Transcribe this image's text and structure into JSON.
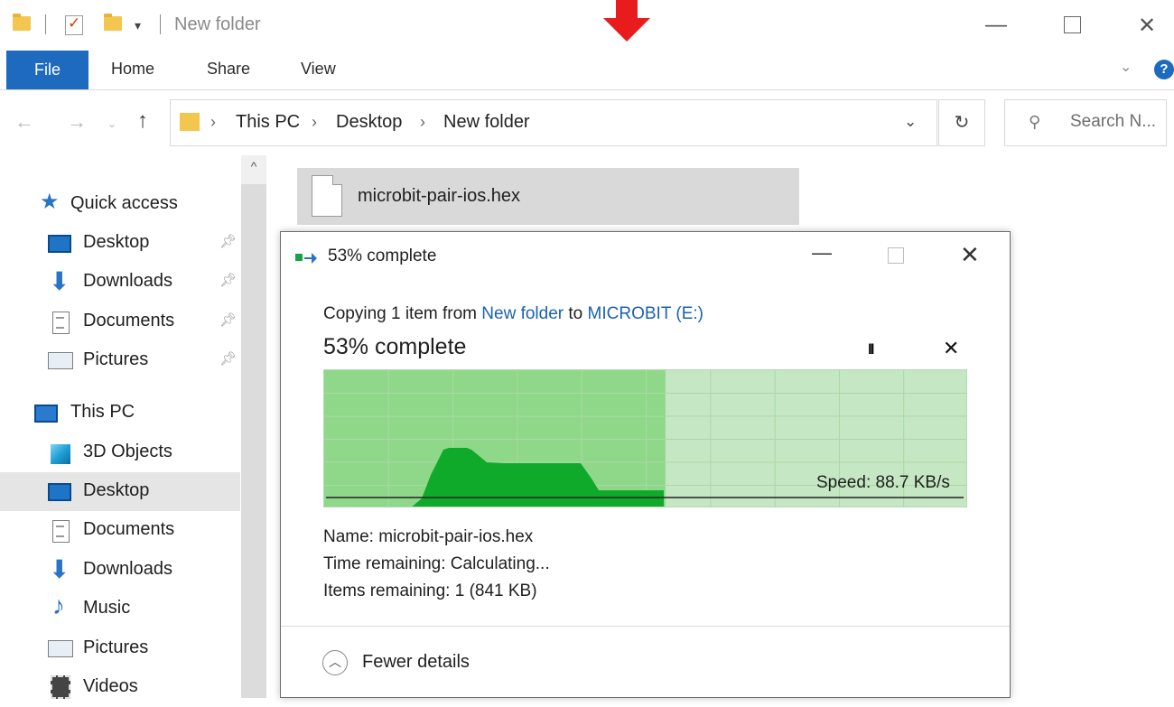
{
  "window": {
    "title": "New folder",
    "qat_dropdown": "▾",
    "controls": {
      "minimize": "—",
      "maximize": "",
      "close": "✕"
    }
  },
  "ribbon": {
    "tabs": [
      "File",
      "Home",
      "Share",
      "View"
    ],
    "expand_chevron": "⌄",
    "help": "?"
  },
  "address": {
    "back": "←",
    "forward": "→",
    "recent": "⌄",
    "up": "↑",
    "breadcrumbs": [
      "This PC",
      "Desktop",
      "New folder"
    ],
    "separator": "›",
    "dropdown": "⌄",
    "refresh": "↻",
    "search_placeholder": "Search N..."
  },
  "nav_pane": {
    "quick_access": {
      "label": "Quick access",
      "items": [
        "Desktop",
        "Downloads",
        "Documents",
        "Pictures"
      ]
    },
    "this_pc": {
      "label": "This PC",
      "items": [
        "3D Objects",
        "Desktop",
        "Documents",
        "Downloads",
        "Music",
        "Pictures",
        "Videos"
      ]
    },
    "selected": "Desktop",
    "scroll_up": "^"
  },
  "file_list": {
    "items": [
      "microbit-pair-ios.hex"
    ]
  },
  "copy_dialog": {
    "title": "53% complete",
    "copy_prefix": "Copying 1 item from",
    "source": "New folder",
    "to_word": "to",
    "destination": "MICROBIT (E:)",
    "progress_label": "53% complete",
    "progress_percent": 53,
    "pause": "II",
    "cancel": "✕",
    "speed": "Speed: 88.7 KB/s",
    "name": "Name:  microbit-pair-ios.hex",
    "time_remaining": "Time remaining:  Calculating...",
    "items_remaining": "Items remaining:  1 (841 KB)",
    "fewer_details": "Fewer details",
    "fewer_icon": "︿",
    "controls": {
      "minimize": "—",
      "close": "✕"
    }
  },
  "colors": {
    "accent": "#1d6abf",
    "progress_fill": "#8fd88a",
    "progress_bg": "#c6e7c4",
    "speed_curve": "#0faa2a",
    "link": "#1a62b5",
    "annotation_arrow": "#e81c1c"
  }
}
